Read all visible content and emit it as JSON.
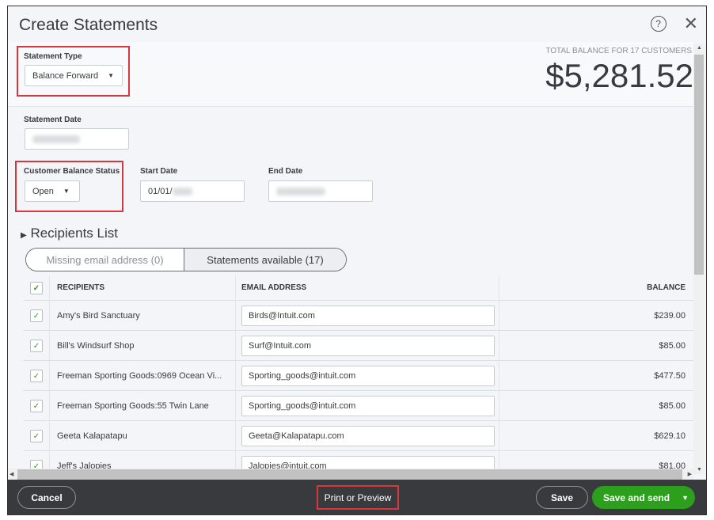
{
  "dialog": {
    "title": "Create Statements",
    "help_icon": "question-circle-icon",
    "close_icon": "close-icon"
  },
  "summary": {
    "label": "TOTAL BALANCE FOR 17 CUSTOMERS",
    "amount": "$5,281.52"
  },
  "form": {
    "statement_type": {
      "label": "Statement Type",
      "value": "Balance Forward"
    },
    "statement_date": {
      "label": "Statement Date"
    },
    "customer_balance_status": {
      "label": "Customer Balance Status",
      "value": "Open"
    },
    "start_date": {
      "label": "Start Date",
      "value": "01/01/"
    },
    "end_date": {
      "label": "End Date"
    }
  },
  "recipients": {
    "title": "Recipients List",
    "tabs": [
      {
        "label": "Missing email address (0)",
        "active": false
      },
      {
        "label": "Statements available (17)",
        "active": true
      }
    ],
    "columns": [
      "RECIPIENTS",
      "EMAIL ADDRESS",
      "BALANCE"
    ],
    "rows": [
      {
        "name": "Amy's Bird Sanctuary",
        "email": "Birds@Intuit.com",
        "balance": "$239.00",
        "checked": true
      },
      {
        "name": "Bill's Windsurf Shop",
        "email": "Surf@Intuit.com",
        "balance": "$85.00",
        "checked": true
      },
      {
        "name": "Freeman Sporting Goods:0969 Ocean Vi...",
        "email": "Sporting_goods@intuit.com",
        "balance": "$477.50",
        "checked": true
      },
      {
        "name": "Freeman Sporting Goods:55 Twin Lane",
        "email": "Sporting_goods@intuit.com",
        "balance": "$85.00",
        "checked": true
      },
      {
        "name": "Geeta Kalapatapu",
        "email": "Geeta@Kalapatapu.com",
        "balance": "$629.10",
        "checked": true
      },
      {
        "name": "Jeff's Jalopies",
        "email": "Jalopies@intuit.com",
        "balance": "$81.00",
        "checked": true
      }
    ]
  },
  "footer": {
    "cancel": "Cancel",
    "print_preview": "Print or Preview",
    "save": "Save",
    "save_send": "Save and send"
  },
  "colors": {
    "accent_green": "#2ca01c",
    "highlight_red": "#d9363e",
    "footer_bg": "#393a3d"
  }
}
